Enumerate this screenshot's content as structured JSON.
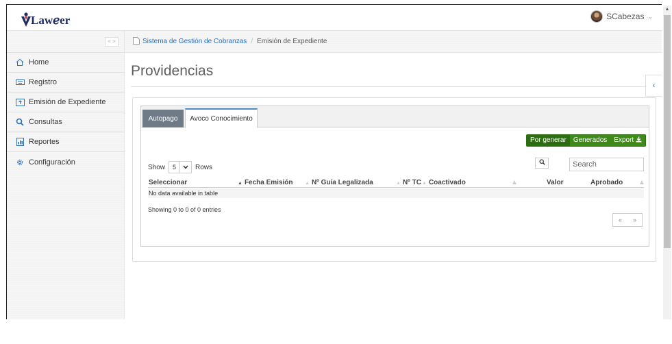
{
  "header": {
    "logo_text": "Lawℯer",
    "user_name": "SCabezas"
  },
  "sidebar": {
    "toggle_label": "< >",
    "items": [
      {
        "label": "Home",
        "icon": "home-icon"
      },
      {
        "label": "Registro",
        "icon": "keyboard-icon"
      },
      {
        "label": "Emisión de Expediente",
        "icon": "upload-icon"
      },
      {
        "label": "Consultas",
        "icon": "search-icon"
      },
      {
        "label": "Reportes",
        "icon": "report-icon"
      },
      {
        "label": "Configuración",
        "icon": "gear-icon"
      }
    ]
  },
  "breadcrumb": {
    "root": "Sistema de Gestión de Cobranzas",
    "separator": "/",
    "current": "Emisión de Expediente"
  },
  "page": {
    "title": "Providencias"
  },
  "tabs": [
    {
      "label": "Autopago",
      "active": false
    },
    {
      "label": "Avoco Conocimiento",
      "active": true
    }
  ],
  "actions": {
    "por_generar": "Por generar",
    "generados": "Generados",
    "export": "Export"
  },
  "table": {
    "show_label": "Show",
    "rows_value": "5",
    "rows_label": "Rows",
    "search_placeholder": "Search",
    "columns": [
      "Seleccionar",
      "Fecha Emisión",
      "Nº Guía Legalizada",
      "Nº TC",
      "Coactivado",
      "Valor",
      "Aprobado"
    ],
    "empty_text": "No data available in table",
    "info_text": "Showing 0 to 0 of 0 entries",
    "pager_prev": "«",
    "pager_next": "»"
  },
  "colors": {
    "accent_green": "#3d8a1b",
    "tab_inactive": "#6f7b87",
    "link_blue": "#2a6ebb"
  }
}
